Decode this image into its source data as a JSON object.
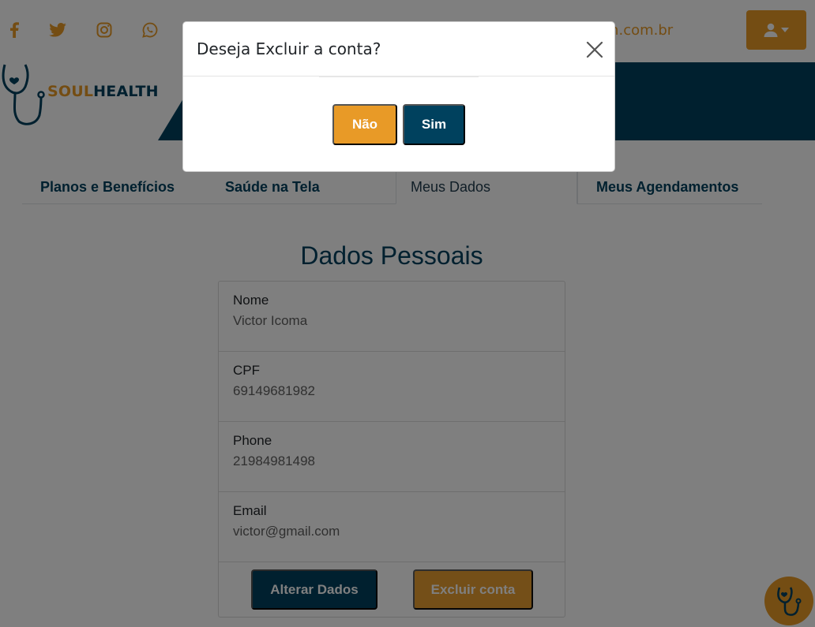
{
  "colors": {
    "accent": "#e89a27",
    "brand_dark": "#00415e",
    "backdrop": "rgba(0,0,0,0.5)"
  },
  "header": {
    "social_icons": [
      "facebook-icon",
      "twitter-icon",
      "instagram-icon",
      "whatsapp-icon"
    ],
    "contact_email_fragment": "lth.com.br",
    "user_menu_icon": "user-icon"
  },
  "brand": {
    "logo_soul": "SOUL",
    "logo_health": "HEALTH"
  },
  "tabs": [
    {
      "label": "Planos e Benefícios",
      "active": false
    },
    {
      "label": "Saúde na Tela",
      "active": false
    },
    {
      "label": "Meus Dados",
      "active": true
    },
    {
      "label": "Meus Agendamentos",
      "active": false
    }
  ],
  "profile": {
    "title": "Dados Pessoais",
    "fields": [
      {
        "label": "Nome",
        "value": "Victor Icoma"
      },
      {
        "label": "CPF",
        "value": "69149681982"
      },
      {
        "label": "Phone",
        "value": "21984981498"
      },
      {
        "label": "Email",
        "value": "victor@gmail.com"
      }
    ],
    "alter_label": "Alterar Dados",
    "delete_label": "Excluir conta"
  },
  "modal": {
    "title": "Deseja Excluir a conta?",
    "no_label": "Não",
    "yes_label": "Sim",
    "close_icon": "close-icon"
  },
  "fab_icon": "stethoscope-icon"
}
